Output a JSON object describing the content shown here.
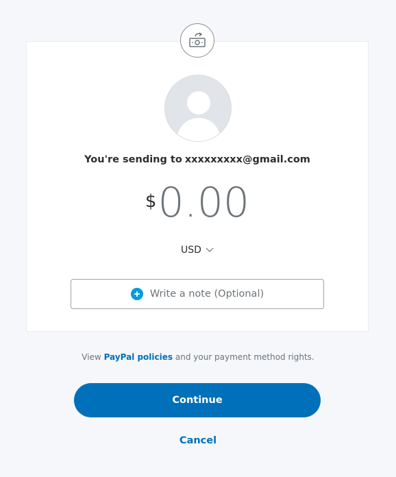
{
  "header": {
    "icon": "send-money-icon"
  },
  "recipient": {
    "avatar_icon": "default-avatar-icon",
    "prefix": "You're sending to",
    "email": "xxxxxxxxx@gmail.com"
  },
  "amount": {
    "currency_symbol": "$",
    "value": "0.00"
  },
  "currency_selector": {
    "selected": "USD",
    "icon": "chevron-down-icon"
  },
  "note": {
    "icon": "plus-circle-icon",
    "label": "Write a note (Optional)"
  },
  "policy": {
    "prefix": "View",
    "link": "PayPal policies",
    "suffix": "and your payment method rights."
  },
  "actions": {
    "continue_label": "Continue",
    "cancel_label": "Cancel"
  },
  "colors": {
    "brand_blue": "#0070ba",
    "accent_blue": "#009cde",
    "background": "#f5f7fa"
  }
}
